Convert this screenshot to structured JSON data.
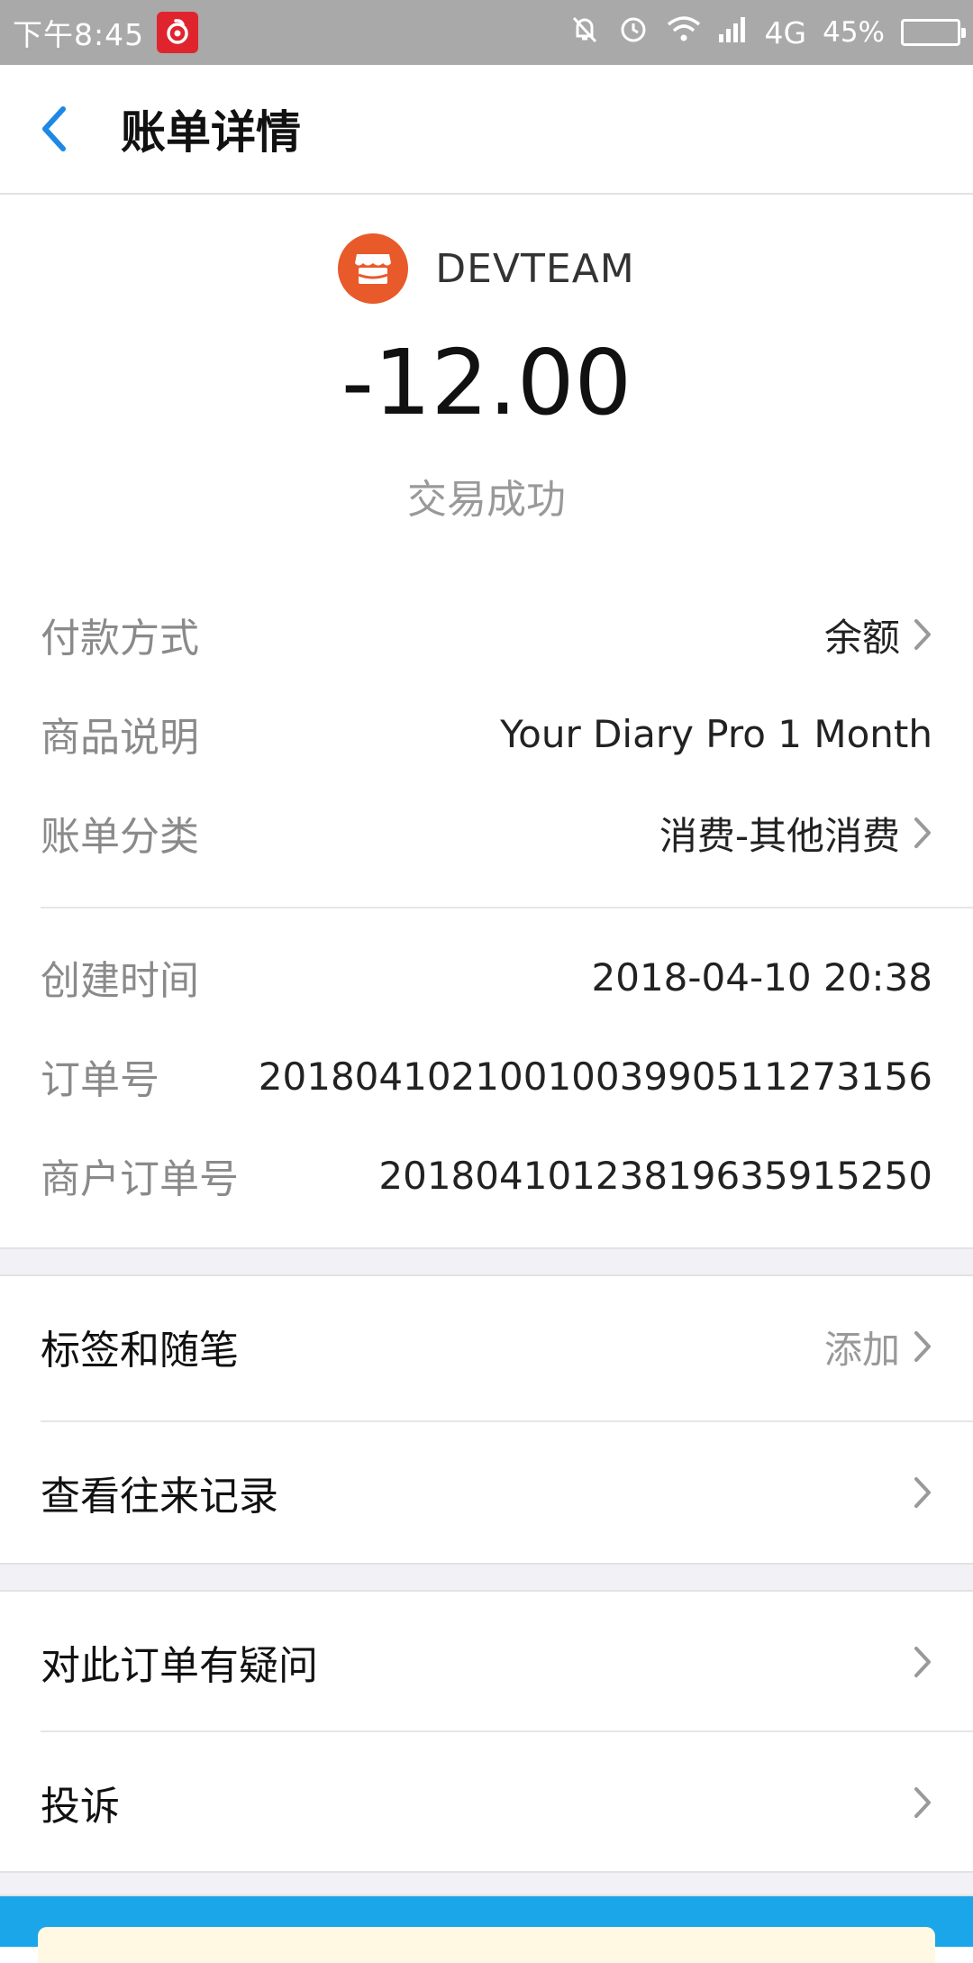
{
  "status_bar": {
    "time": "下午8:45",
    "network": "4G",
    "battery_pct": "45%",
    "battery_level": 0.45
  },
  "nav": {
    "title": "账单详情"
  },
  "summary": {
    "merchant_name": "DEVTEAM",
    "amount": "-12.00",
    "status": "交易成功"
  },
  "details": {
    "payment_method": {
      "label": "付款方式",
      "value": "余额"
    },
    "product_desc": {
      "label": "商品说明",
      "value": "Your Diary Pro 1 Month"
    },
    "category": {
      "label": "账单分类",
      "value": "消费-其他消费"
    },
    "created_time": {
      "label": "创建时间",
      "value": "2018-04-10 20:38"
    },
    "order_no": {
      "label": "订单号",
      "value": "20180410210010039905112731​56"
    },
    "merchant_order_no": {
      "label": "商户订单号",
      "value": "20180410123819635915250"
    }
  },
  "actions": {
    "tags_notes": {
      "label": "标签和随笔",
      "hint": "添加"
    },
    "history": {
      "label": "查看往来记录"
    },
    "question": {
      "label": "对此订单有疑问"
    },
    "complaint": {
      "label": "投诉"
    }
  },
  "colors": {
    "accent_blue": "#1e88e5",
    "merchant_orange": "#e85a2a",
    "status_bar": "#a9a9a9",
    "bottom_band": "#1aa6e8"
  }
}
